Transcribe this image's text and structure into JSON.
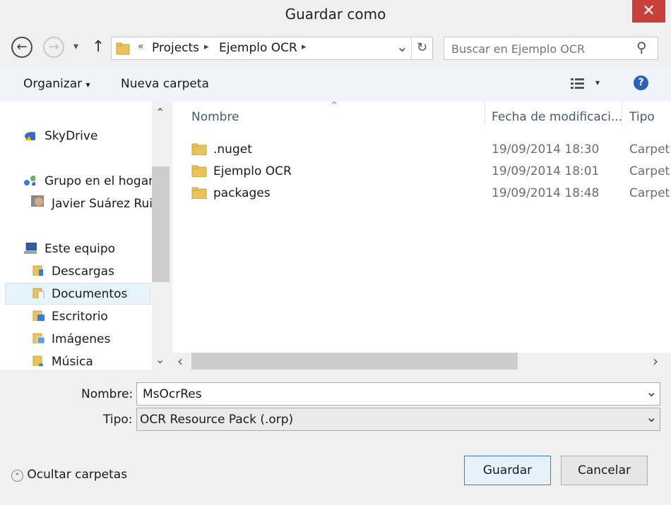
{
  "window": {
    "title": "Guardar como",
    "close_glyph": "✕"
  },
  "nav": {
    "back_glyph": "←",
    "forward_glyph": "→",
    "history_glyph": "▾",
    "up_glyph": "↑",
    "breadcrumb": {
      "overflow": "«",
      "items": [
        "Projects",
        "Ejemplo OCR"
      ],
      "sep": "▸"
    },
    "dropdown_glyph": "⌄",
    "refresh_glyph": "↻",
    "search_placeholder": "Buscar en Ejemplo OCR",
    "search_glyph": "⚲"
  },
  "toolbar": {
    "organize_label": "Organizar",
    "organize_arrow": "▾",
    "new_folder_label": "Nueva carpeta",
    "view_arrow": "▾",
    "help_glyph": "?"
  },
  "sidebar": {
    "scroll_up": "⌃",
    "scroll_down": "⌄",
    "items": [
      {
        "label": "SkyDrive",
        "icon": "skydrive-warning-icon"
      },
      {
        "label": "Grupo en el hogar",
        "icon": "homegroup-icon"
      },
      {
        "label": "Javier Suárez Ruiz",
        "icon": "user-avatar-icon"
      },
      {
        "label": "Este equipo",
        "icon": "computer-icon"
      },
      {
        "label": "Descargas",
        "icon": "downloads-folder-icon"
      },
      {
        "label": "Documentos",
        "icon": "documents-folder-icon"
      },
      {
        "label": "Escritorio",
        "icon": "desktop-folder-icon"
      },
      {
        "label": "Imágenes",
        "icon": "pictures-folder-icon"
      },
      {
        "label": "Música",
        "icon": "music-folder-icon"
      }
    ]
  },
  "files": {
    "columns": {
      "name": "Nombre",
      "date": "Fecha de modificaci...",
      "type": "Tipo"
    },
    "sort_glyph": "^",
    "rows": [
      {
        "name": ".nuget",
        "date": "19/09/2014 18:30",
        "type": "Carpet"
      },
      {
        "name": "Ejemplo OCR",
        "date": "19/09/2014 18:01",
        "type": "Carpet"
      },
      {
        "name": "packages",
        "date": "19/09/2014 18:48",
        "type": "Carpet"
      }
    ],
    "scroll_left": "‹",
    "scroll_right": "›"
  },
  "form": {
    "name_label": "Nombre:",
    "name_value": "MsOcrRes",
    "type_label": "Tipo:",
    "type_value": "OCR Resource Pack (.orp)",
    "dropdown_glyph": "⌄"
  },
  "footer": {
    "hide_folders_glyph": "⌃",
    "hide_folders_label": "Ocultar carpetas",
    "save_label": "Guardar",
    "cancel_label": "Cancelar"
  },
  "colors": {
    "close": "#c7403a",
    "folder": "#e8c25a",
    "accent": "#3c7fd1"
  }
}
